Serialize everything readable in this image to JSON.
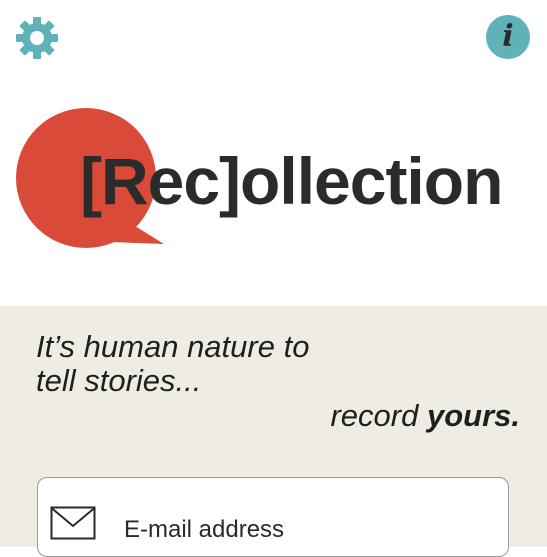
{
  "logo": {
    "prefix": "[Rec]",
    "suffix": "ollection"
  },
  "tagline": {
    "line1": "It’s human nature to",
    "line2": "tell stories...",
    "line3_regular": "record ",
    "line3_bold": "yours."
  },
  "email": {
    "placeholder": "E-mail address"
  },
  "icons": {
    "settings": "gear-icon",
    "info": "info-icon",
    "mail": "envelope-icon"
  },
  "colors": {
    "accent": "#5fb3b8",
    "brand": "#d94a38",
    "panel": "#efece3"
  }
}
